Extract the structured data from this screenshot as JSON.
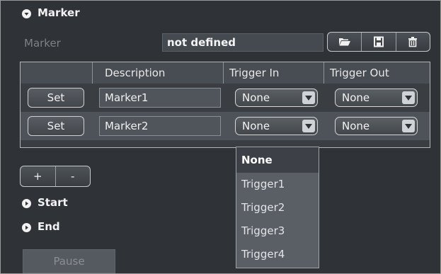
{
  "section": {
    "title": "Marker",
    "icon": "chevron-down-icon"
  },
  "marker_field": {
    "label": "Marker",
    "value": "not defined"
  },
  "toolbar": {
    "icons": [
      "folder-open-icon",
      "save-icon",
      "trash-icon"
    ]
  },
  "table": {
    "columns": [
      "",
      "Description",
      "Trigger In",
      "Trigger Out"
    ],
    "rows": [
      {
        "set_label": "Set",
        "description": "Marker1",
        "trigger_in": "None",
        "trigger_out": "None"
      },
      {
        "set_label": "Set",
        "description": "Marker2",
        "trigger_in": "None",
        "trigger_out": "None"
      }
    ]
  },
  "add_remove": {
    "add": "+",
    "remove": "-"
  },
  "start": {
    "label": "Start"
  },
  "end": {
    "label": "End"
  },
  "pause_button": {
    "label": "Pause"
  },
  "trigger_dropdown": {
    "options": [
      "None",
      "Trigger1",
      "Trigger2",
      "Trigger3",
      "Trigger4"
    ],
    "selected": "None"
  },
  "colors": {
    "background": "#2f3236",
    "panel": "#3a3e43",
    "selected_row": "#4e535a",
    "text": "#e8e8e8",
    "disabled_text": "#7d8186"
  }
}
